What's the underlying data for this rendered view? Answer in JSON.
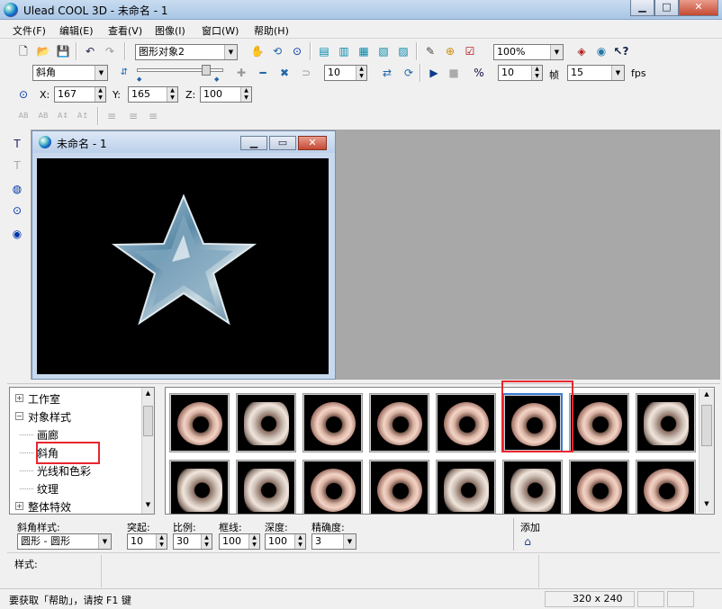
{
  "window": {
    "title": "Ulead COOL 3D - 未命名 - 1"
  },
  "menu": [
    "文件(F)",
    "编辑(E)",
    "查看(V)",
    "图像(I)",
    "窗口(W)",
    "帮助(H)"
  ],
  "toolbar1": {
    "object_combo": "图形对象2",
    "zoom_combo": "100%"
  },
  "toolbar2": {
    "effect_combo": "斜角",
    "frame_value": "10",
    "frame_count": "10",
    "frame_label": "帧",
    "fps_value": "15",
    "fps_label": "fps"
  },
  "toolbar3": {
    "x_label": "X:",
    "x_value": "167",
    "y_label": "Y:",
    "y_value": "165",
    "z_label": "Z:",
    "z_value": "100"
  },
  "document": {
    "title": "未命名 - 1"
  },
  "tree": {
    "items": [
      {
        "label": "工作室",
        "indent": 0,
        "toggle": "+"
      },
      {
        "label": "对象样式",
        "indent": 0,
        "toggle": "-"
      },
      {
        "label": "画廊",
        "indent": 1,
        "toggle": ""
      },
      {
        "label": "斜角",
        "indent": 1,
        "toggle": ""
      },
      {
        "label": "光线和色彩",
        "indent": 1,
        "toggle": ""
      },
      {
        "label": "纹理",
        "indent": 1,
        "toggle": ""
      },
      {
        "label": "整体特效",
        "indent": 0,
        "toggle": "+"
      }
    ],
    "selected": "斜角"
  },
  "params": {
    "bevel_style_label": "斜角样式:",
    "bevel_style_value": "圆形 - 圆形",
    "protrude_label": "突起:",
    "protrude_value": "10",
    "scale_label": "比例:",
    "scale_value": "30",
    "frame_label": "框线:",
    "frame_value": "100",
    "depth_label": "深度:",
    "depth_value": "100",
    "precision_label": "精确度:",
    "precision_value": "3",
    "add_label": "添加"
  },
  "style_label": "样式:",
  "status": {
    "help_text": "要获取「帮助」，请按 F1 键",
    "size": "320 x 240"
  },
  "colors": {
    "highlight": "#e8262e",
    "canvas": "#000000",
    "mdi_bg": "#a8a8a8",
    "star": "#8fb3c6"
  },
  "icons": [
    "new-icon",
    "open-icon",
    "save-icon",
    "undo-icon",
    "redo-icon",
    "hand-icon",
    "rotate-icon",
    "zoom-icon",
    "play-icon",
    "stop-icon",
    "globe-icon",
    "help-icon"
  ]
}
